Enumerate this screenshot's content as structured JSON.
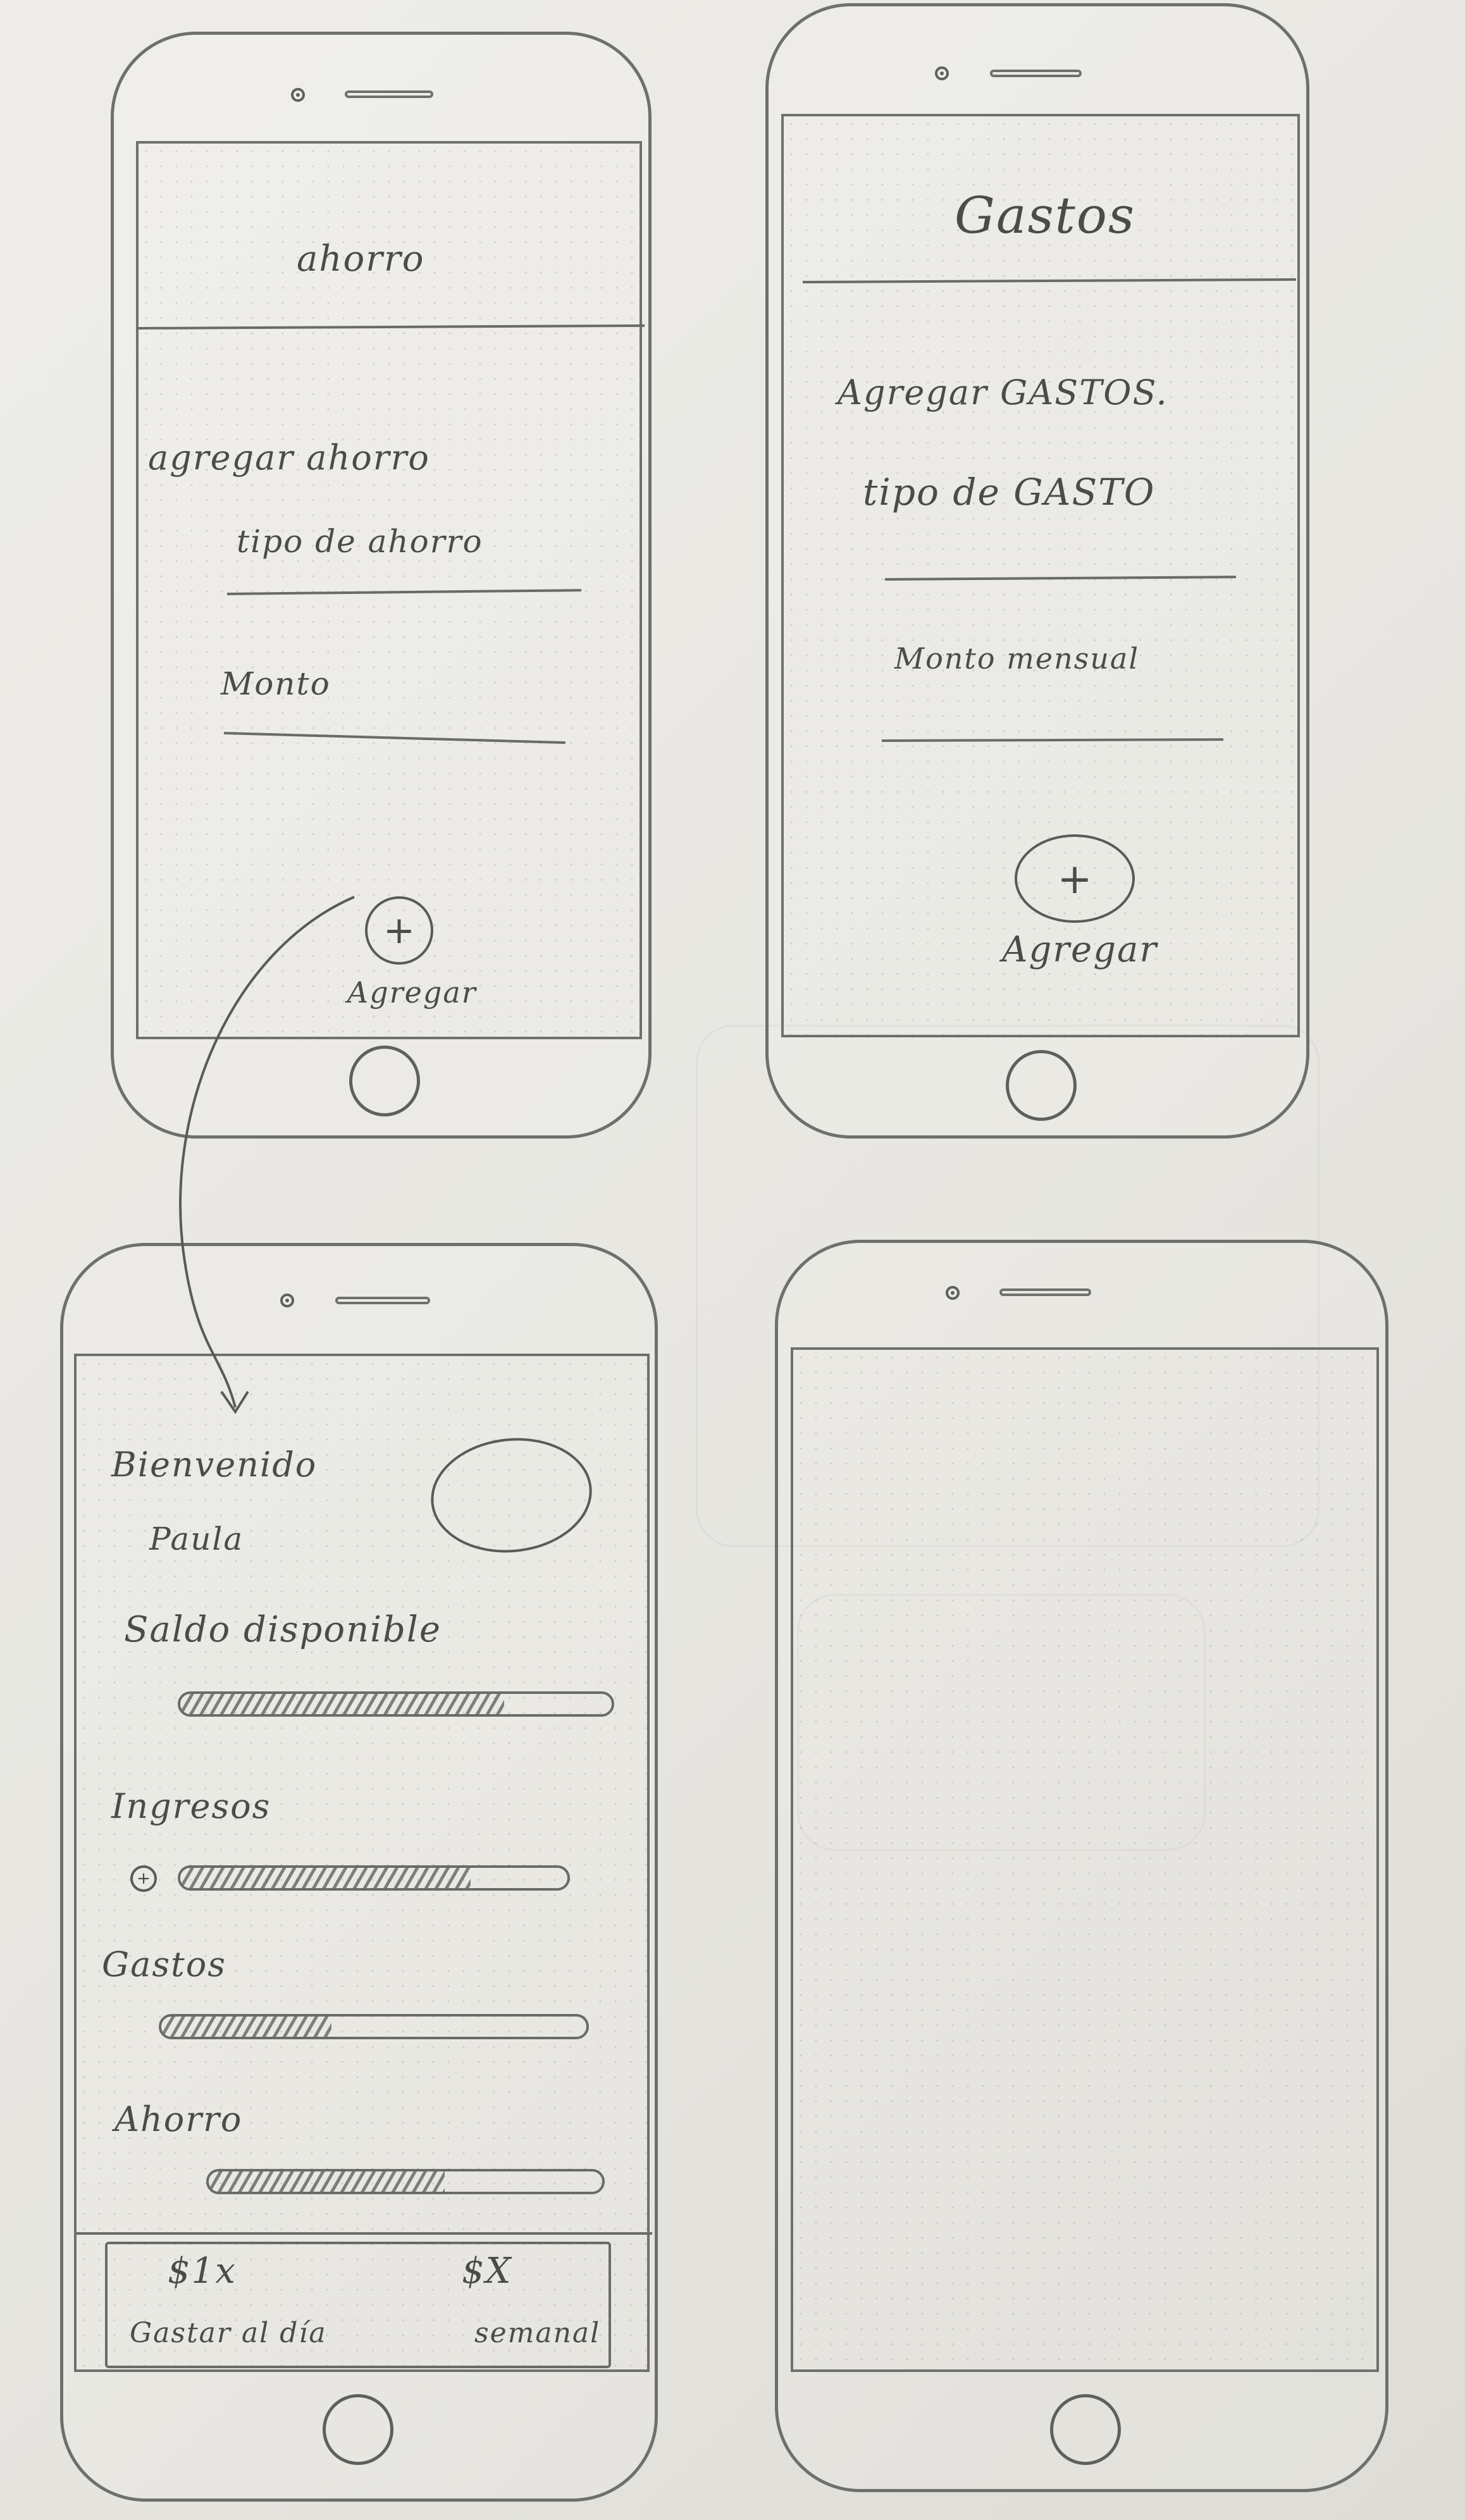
{
  "screens": {
    "ahorro": {
      "header_title": "ahorro",
      "add_label": "agregar ahorro",
      "type_field_label": "tipo de ahorro",
      "amount_field_label": "Monto",
      "add_button_symbol": "+",
      "add_button_label": "Agregar"
    },
    "gastos": {
      "header_title": "Gastos",
      "add_label": "Agregar GASTOS.",
      "type_field_label": "tipo de GASTO",
      "amount_field_label": "Monto mensual",
      "add_button_symbol": "+",
      "add_button_label": "Agregar"
    },
    "dashboard": {
      "greeting_line1": "Bienvenido",
      "greeting_line2": "Paula",
      "balance_label": "Saldo disponible",
      "income_label": "Ingresos",
      "income_add_symbol": "+",
      "expenses_label": "Gastos",
      "savings_label": "Ahorro",
      "bars": {
        "balance": 0.75,
        "income": 0.75,
        "expenses": 0.4,
        "savings": 0.6
      },
      "footer": {
        "left_value": "$1x",
        "left_label": "Gastar al día",
        "right_value": "$X",
        "right_label": "semanal"
      }
    },
    "blank": {}
  },
  "colors": {
    "pencil": "#5a5a56",
    "paper": "#e9e8e3"
  }
}
